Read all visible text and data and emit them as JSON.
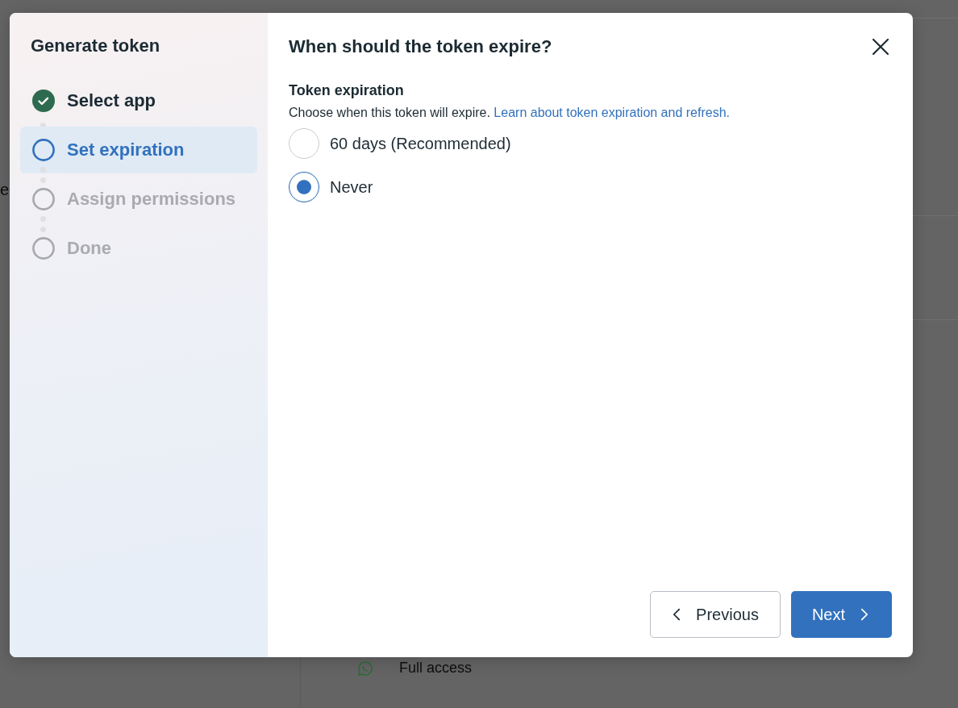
{
  "background": {
    "fragment": "e",
    "access_label": "Full access"
  },
  "sidebar": {
    "title": "Generate token",
    "steps": [
      {
        "label": "Select app",
        "kind": "done",
        "selected": false
      },
      {
        "label": "Set expiration",
        "kind": "current",
        "selected": true
      },
      {
        "label": "Assign permissions",
        "kind": "upcoming",
        "selected": false
      },
      {
        "label": "Done",
        "kind": "upcoming",
        "selected": false
      }
    ]
  },
  "dialog": {
    "title": "When should the token expire?",
    "section_title": "Token expiration",
    "description": "Choose when this token will expire.",
    "link": "Learn about token expiration and refresh.",
    "options": [
      {
        "label": "60 days (Recommended)",
        "selected": false
      },
      {
        "label": "Never",
        "selected": true
      }
    ],
    "buttons": [
      {
        "label": "Previous",
        "kind": "secondary"
      },
      {
        "label": "Next",
        "kind": "primary"
      }
    ]
  }
}
